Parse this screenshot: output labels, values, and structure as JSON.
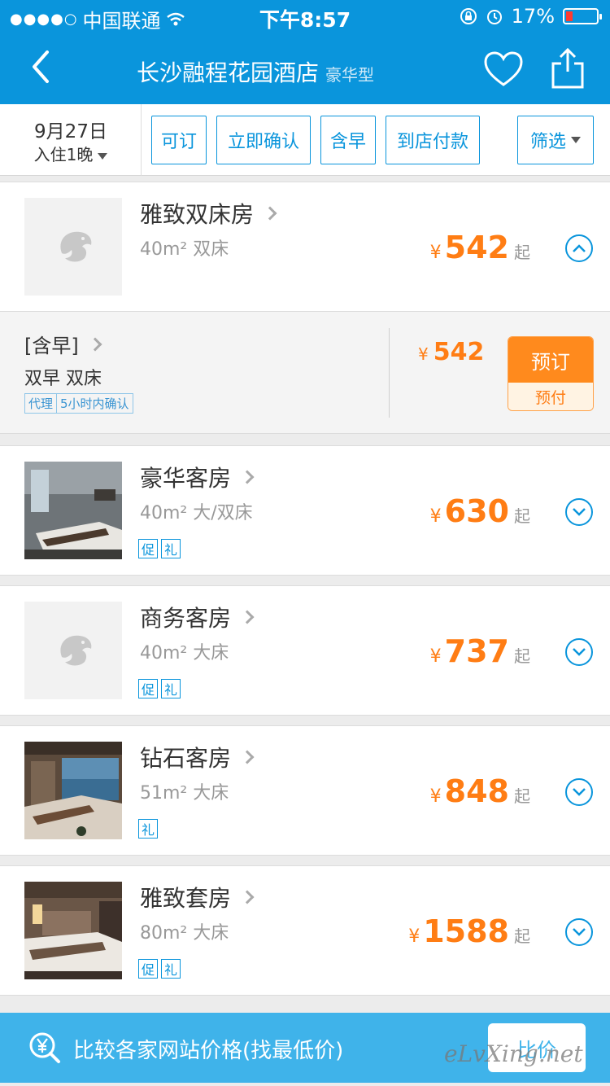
{
  "status": {
    "carrier": "中国联通",
    "time": "下午8:57",
    "battery": "17%"
  },
  "header": {
    "title": "长沙融程花园酒店",
    "subtitle": "豪华型"
  },
  "filters": {
    "date": "9月27日",
    "nights": "入住1晚",
    "chips": [
      "可订",
      "立即确认",
      "含早",
      "到店付款"
    ],
    "filter_label": "筛选"
  },
  "rooms": [
    {
      "name": "雅致双床房",
      "info": "40m² 双床",
      "tags": [],
      "price": "542",
      "suffix": "起",
      "yen": "¥"
    },
    {
      "name": "豪华客房",
      "info": "40m² 大/双床",
      "tags": [
        "促",
        "礼"
      ],
      "price": "630",
      "suffix": "起",
      "yen": "¥"
    },
    {
      "name": "商务客房",
      "info": "40m² 大床",
      "tags": [
        "促",
        "礼"
      ],
      "price": "737",
      "suffix": "起",
      "yen": "¥"
    },
    {
      "name": "钻石客房",
      "info": "51m² 大床",
      "tags": [
        "礼"
      ],
      "price": "848",
      "suffix": "起",
      "yen": "¥"
    },
    {
      "name": "雅致套房",
      "info": "80m² 大床",
      "tags": [
        "促",
        "礼"
      ],
      "price": "1588",
      "suffix": "起",
      "yen": "¥"
    }
  ],
  "plan": {
    "label": "[含早]",
    "detail": "双早  双床",
    "badge_1": "代理",
    "badge_2": "5小时内确认",
    "yen": "¥",
    "price": "542",
    "book_label": "预订",
    "pay_label": "预付"
  },
  "compare": {
    "text": "比较各家网站价格(找最低价)",
    "button": "比价"
  },
  "watermark": "eLvXing.net",
  "colors": {
    "brand": "#0a95dc",
    "price": "#ff7d14",
    "banner": "#3fb3ea"
  }
}
